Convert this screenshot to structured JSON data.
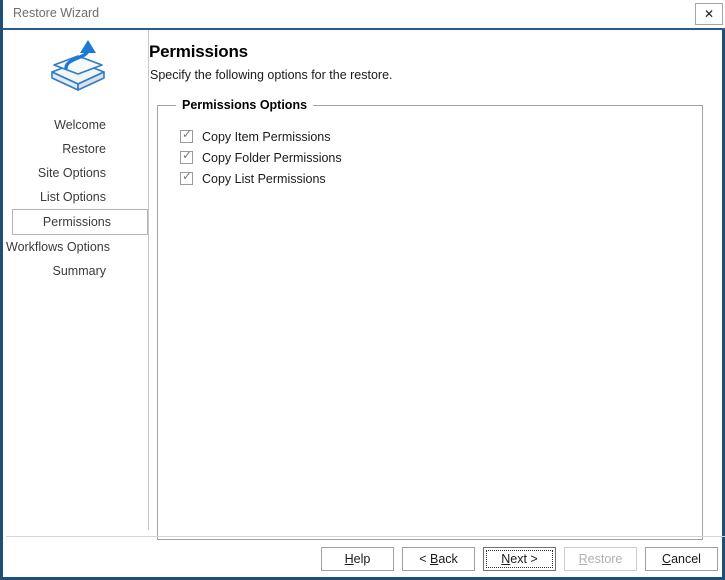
{
  "window": {
    "title": "Restore Wizard",
    "close_label": "✕",
    "accent_color": "#1f4e79"
  },
  "sidebar": {
    "icon_name": "restore-box-arrow-icon",
    "items": [
      {
        "label": "Welcome",
        "current": false
      },
      {
        "label": "Restore",
        "current": false
      },
      {
        "label": "Site Options",
        "current": false
      },
      {
        "label": "List Options",
        "current": false
      },
      {
        "label": "Permissions",
        "current": true
      },
      {
        "label": "Workflows Options",
        "current": false
      },
      {
        "label": "Summary",
        "current": false
      }
    ]
  },
  "page": {
    "title": "Permissions",
    "subtitle": "Specify the following options for the restore."
  },
  "group": {
    "legend": "Permissions Options",
    "options": [
      {
        "label": "Copy Item Permissions",
        "checked": true
      },
      {
        "label": "Copy Folder Permissions",
        "checked": true
      },
      {
        "label": "Copy List Permissions",
        "checked": true
      }
    ]
  },
  "footer": {
    "buttons": [
      {
        "label": "Help",
        "mnemonic": "H",
        "state": "normal"
      },
      {
        "label": "< Back",
        "mnemonic": "B",
        "state": "normal"
      },
      {
        "label": "Next >",
        "mnemonic": "N",
        "state": "focused"
      },
      {
        "label": "Restore",
        "mnemonic": "R",
        "state": "disabled"
      },
      {
        "label": "Cancel",
        "mnemonic": "C",
        "state": "normal"
      }
    ]
  }
}
